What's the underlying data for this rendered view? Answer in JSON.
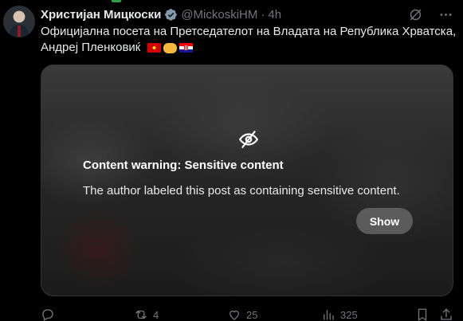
{
  "tweet": {
    "author_name": "Христијан Мицкоски",
    "handle": "@MickoskiHM",
    "separator": "·",
    "time": "4h",
    "text": "Официјална посета на Претседателот на Владата на Република Хрватска, Андреј Пленковиќ",
    "emojis": [
      "flag-north-macedonia",
      "handshake",
      "flag-croatia"
    ]
  },
  "media": {
    "warning_title": "Content warning: Sensitive content",
    "warning_description": "The author labeled this post as containing sensitive content.",
    "show_label": "Show"
  },
  "actions": {
    "replies": "",
    "reposts": "4",
    "likes": "25",
    "views": "325"
  },
  "colors": {
    "background": "#000000",
    "text_primary": "#e7e9ea",
    "text_secondary": "#71767b",
    "verified": "#829aab"
  }
}
